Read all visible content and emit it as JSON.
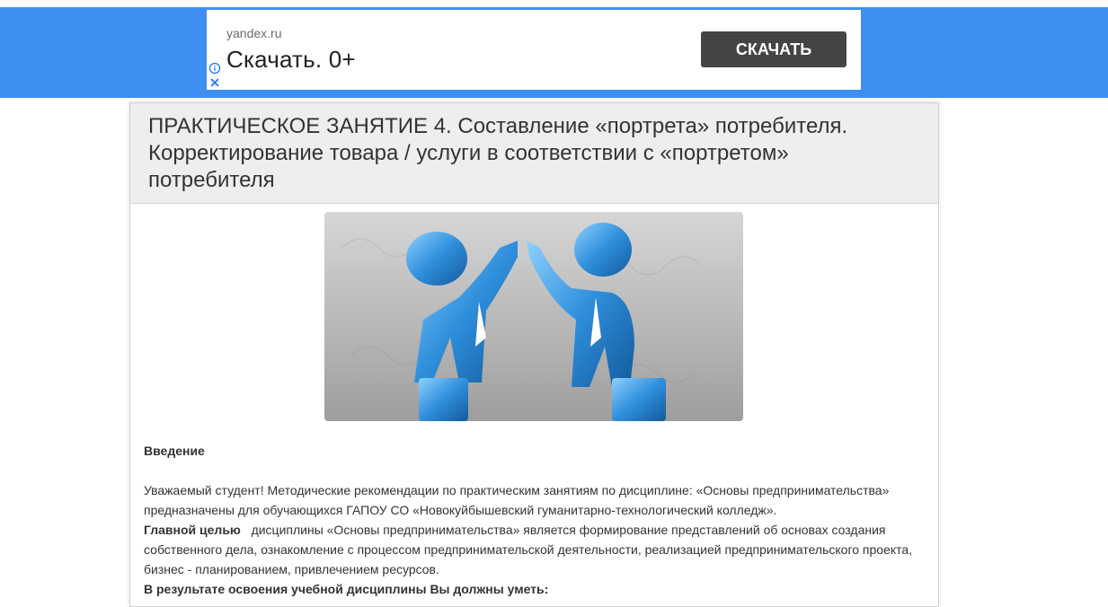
{
  "ad": {
    "domain": "yandex.ru",
    "headline": "Скачать. 0+",
    "button_label": "СКАЧАТЬ",
    "icons": [
      "info-icon",
      "close-icon"
    ],
    "band_color": "#3f8ff0"
  },
  "article": {
    "title": "ПРАКТИЧЕСКОЕ ЗАНЯТИЕ 4. Составление «портрета» потребителя. Корректирование товара / услуги в соответствии с «портретом» потребителя",
    "hero_image": "two-businessmen-high-five-illustration",
    "intro_heading": "Введение",
    "intro_paragraph": "Уважаемый студент! Методические рекомендации по практическим занятиям по дисциплине: «Основы предпринимательства» предназначены для обучающихся ГАПОУ СО «Новокуйбышевский гуманитарно-технологический колледж».",
    "goal_label": "Главной целью",
    "goal_text": "дисциплины «Основы предпринимательства» является формирование представлений об основах создания собственного дела, ознакомление с процессом предпринимательской деятельности, реализацией предпринимательского проекта, бизнес - планированием, привлечением ресурсов.",
    "skills_heading": "В результате освоения учебной дисциплины Вы должны уметь:"
  }
}
